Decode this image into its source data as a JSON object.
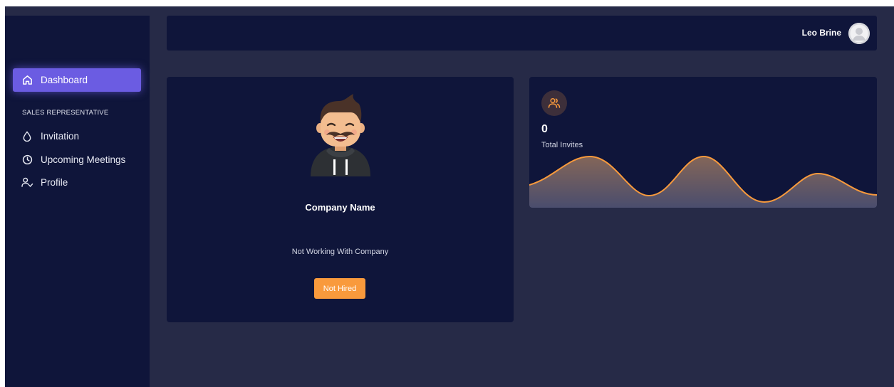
{
  "sidebar": {
    "items": [
      {
        "label": "Dashboard",
        "icon": "home-icon",
        "active": true
      }
    ],
    "section_label": "SALES REPRESENTATIVE",
    "section_items": [
      {
        "label": "Invitation",
        "icon": "drop-icon"
      },
      {
        "label": "Upcoming Meetings",
        "icon": "clock-icon"
      },
      {
        "label": "Profile",
        "icon": "user-check-icon"
      }
    ]
  },
  "header": {
    "user_name": "Leo Brine",
    "avatar_icon": "user-avatar-icon"
  },
  "company_card": {
    "name": "Company Name",
    "status": "Not Working With Company",
    "button_label": "Not Hired",
    "avatar_icon": "cartoon-man-avatar"
  },
  "invites_card": {
    "icon": "users-icon",
    "value": "0",
    "label": "Total Invites"
  },
  "colors": {
    "background": "#262a47",
    "panel": "#0f153a",
    "accent": "#6b5ce2",
    "orange": "#f99a3c",
    "text": "#ffffff"
  }
}
